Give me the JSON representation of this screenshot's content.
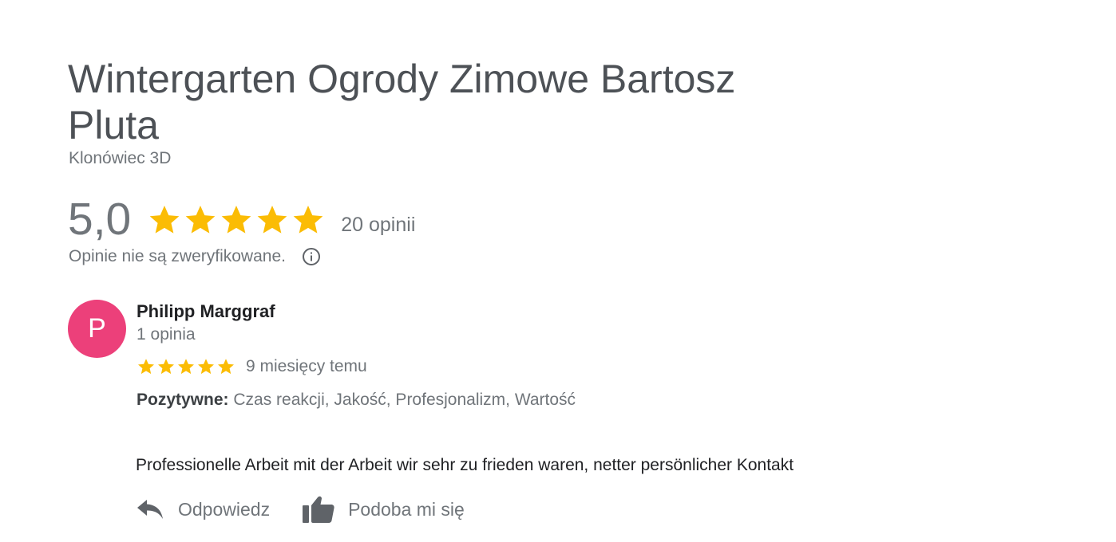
{
  "business": {
    "name": "Wintergarten Ogrody Zimowe Bartosz Pluta",
    "address": "Klonówiec 3D"
  },
  "rating": {
    "value": "5,0",
    "stars": 5,
    "count_label": "20 opinii",
    "verification_note": "Opinie nie są zweryfikowane."
  },
  "review": {
    "avatar_letter": "P",
    "avatar_color": "#ec407a",
    "reviewer_name": "Philipp Marggraf",
    "reviewer_meta": "1 opinia",
    "stars": 5,
    "time": "9 miesięcy temu",
    "positives_label": "Pozytywne:",
    "positives_value": "Czas reakcji, Jakość, Profesjonalizm, Wartość",
    "text": "Professionelle Arbeit mit der Arbeit wir sehr zu frieden waren, netter persönlicher Kontakt"
  },
  "actions": {
    "reply_label": "Odpowiedz",
    "like_label": "Podoba mi się"
  },
  "colors": {
    "star": "#fbbc04",
    "text_secondary": "#70757a"
  }
}
